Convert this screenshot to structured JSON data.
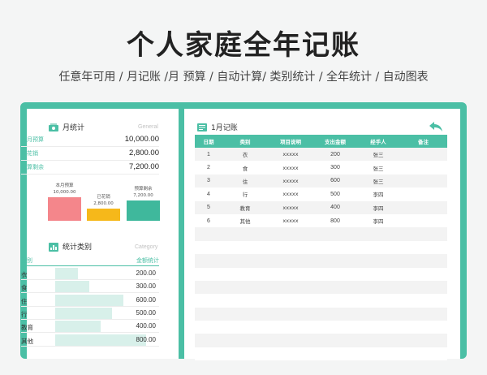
{
  "title": "个人家庭全年记账",
  "subtitle": "任意年可用 / 月记账 /月 预算 / 自动计算/ 类别统计 / 全年统计 / 自动图表",
  "monthly": {
    "header": "月统计",
    "sub": "General",
    "rows": [
      {
        "label": "本月预算",
        "value": "10,000.00"
      },
      {
        "label": "已花销",
        "value": "2,800.00"
      },
      {
        "label": "预算剩余",
        "value": "7,200.00"
      }
    ],
    "chart": {
      "bars": [
        {
          "label": "本月预算",
          "value_text": "10,000.00",
          "value": 10000,
          "color": "#f4868b"
        },
        {
          "label": "已花销",
          "value_text": "2,800.00",
          "value": 2800,
          "color": "#f6b81a"
        },
        {
          "label": "预算剩余",
          "value_text": "7,200.00",
          "value": 7200,
          "color": "#3fb89c"
        }
      ]
    }
  },
  "category": {
    "header": "统计类别",
    "sub": "Category",
    "col_type": "类别",
    "col_amount": "金额统计",
    "max": 800,
    "rows": [
      {
        "name": "衣",
        "value": 200,
        "text": "200.00"
      },
      {
        "name": "食",
        "value": 300,
        "text": "300.00"
      },
      {
        "name": "住",
        "value": 600,
        "text": "600.00"
      },
      {
        "name": "行",
        "value": 500,
        "text": "500.00"
      },
      {
        "name": "教育",
        "value": 400,
        "text": "400.00"
      },
      {
        "name": "其他",
        "value": 800,
        "text": "800.00"
      }
    ]
  },
  "ledger": {
    "header": "1月记账",
    "columns": [
      "日期",
      "类别",
      "项目说明",
      "支出金额",
      "经手人",
      "备注"
    ],
    "rows": [
      [
        "1",
        "衣",
        "xxxxx",
        "200",
        "张三",
        ""
      ],
      [
        "2",
        "食",
        "xxxxx",
        "300",
        "张三",
        ""
      ],
      [
        "3",
        "住",
        "xxxxx",
        "600",
        "张三",
        ""
      ],
      [
        "4",
        "行",
        "xxxxx",
        "500",
        "李四",
        ""
      ],
      [
        "5",
        "教育",
        "xxxxx",
        "400",
        "李四",
        ""
      ],
      [
        "6",
        "其他",
        "xxxxx",
        "800",
        "李四",
        ""
      ],
      [
        "",
        "",
        "",
        "",
        "",
        ""
      ],
      [
        "",
        "",
        "",
        "",
        "",
        ""
      ],
      [
        "",
        "",
        "",
        "",
        "",
        ""
      ],
      [
        "",
        "",
        "",
        "",
        "",
        ""
      ],
      [
        "",
        "",
        "",
        "",
        "",
        ""
      ],
      [
        "",
        "",
        "",
        "",
        "",
        ""
      ],
      [
        "",
        "",
        "",
        "",
        "",
        ""
      ],
      [
        "",
        "",
        "",
        "",
        "",
        ""
      ],
      [
        "",
        "",
        "",
        "",
        "",
        ""
      ],
      [
        "",
        "",
        "",
        "",
        "",
        ""
      ]
    ]
  },
  "colors": {
    "accent": "#4bbfa5",
    "stripe": "#f3f3f3",
    "category_fill": "#d8f0ea"
  },
  "icons": {
    "monthly": "money-icon",
    "category": "bar-chart-icon",
    "ledger": "book-icon",
    "back": "back-arrow-icon"
  }
}
